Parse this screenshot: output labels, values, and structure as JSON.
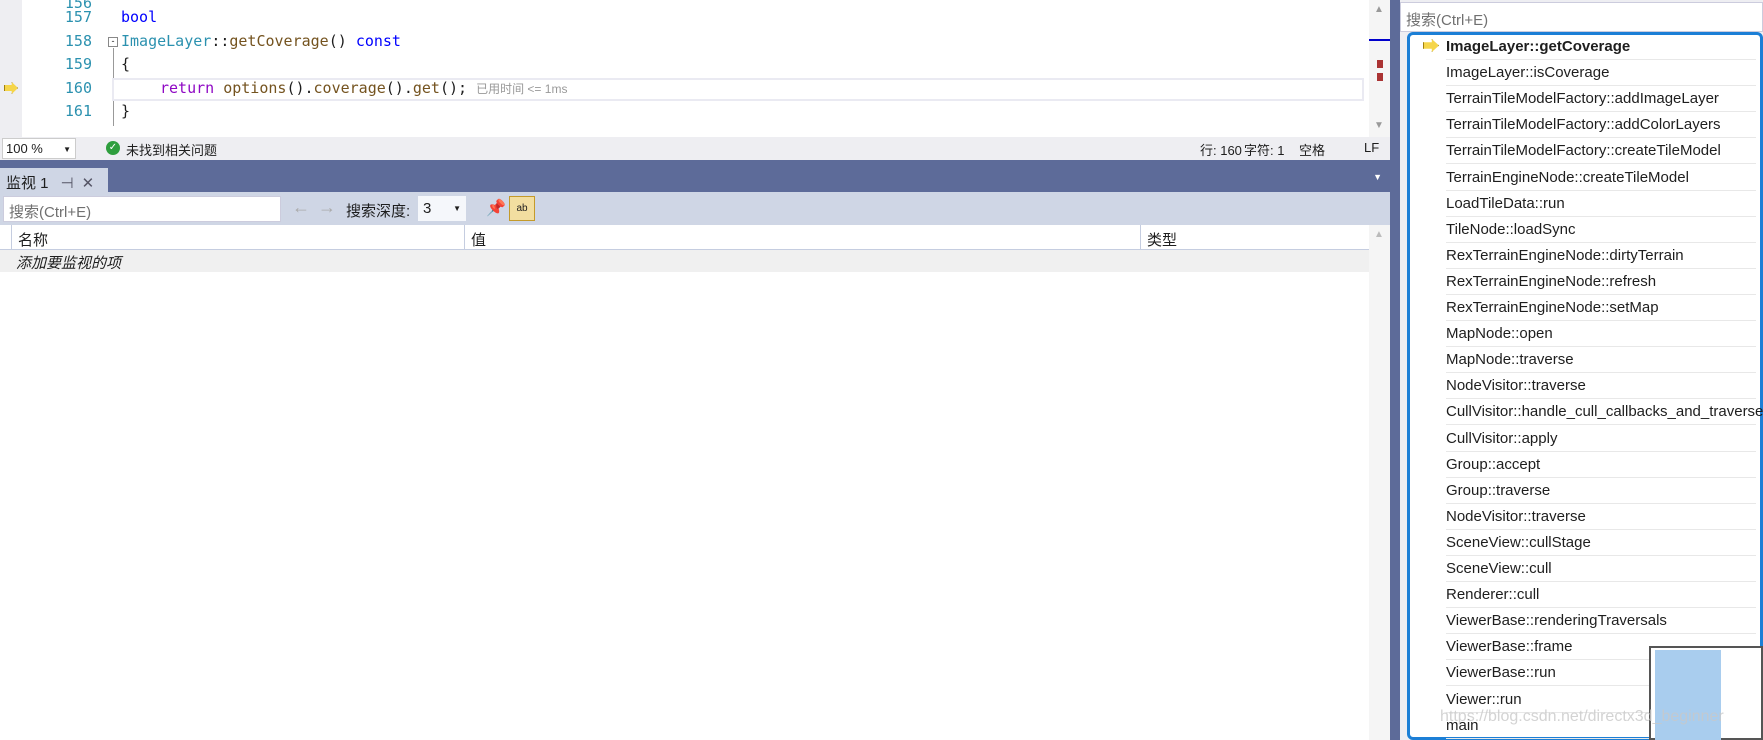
{
  "editor": {
    "lines": [
      {
        "n": "157"
      },
      {
        "n": "158"
      },
      {
        "n": "159"
      },
      {
        "n": "160"
      },
      {
        "n": "161"
      }
    ],
    "code": {
      "l157": "bool",
      "l158_class": "ImageLayer",
      "l158_sep": "::",
      "l158_fn": "getCoverage",
      "l158_rest": "() ",
      "l158_const": "const",
      "l159": "{",
      "l160_ret": "return ",
      "l160_a": "options",
      "l160_b": "().",
      "l160_c": "coverage",
      "l160_d": "().",
      "l160_e": "get",
      "l160_f": "();",
      "l160_hint": "已用时间 <= 1ms",
      "l161": "}"
    }
  },
  "status": {
    "zoom": "100 %",
    "issues": "未找到相关问题",
    "line": "行: 160",
    "char": "字符: 1",
    "indent": "空格",
    "eol": "LF"
  },
  "watch": {
    "tab": "监视 1",
    "search_placeholder": "搜索(Ctrl+E)",
    "depth_label": "搜索深度:",
    "depth": "3",
    "col_name": "名称",
    "col_value": "值",
    "col_type": "类型",
    "add_item": "添加要监视的项"
  },
  "callstack": {
    "search_placeholder": "搜索(Ctrl+E)",
    "frames": [
      "ImageLayer::getCoverage",
      "ImageLayer::isCoverage",
      "TerrainTileModelFactory::addImageLayer",
      "TerrainTileModelFactory::addColorLayers",
      "TerrainTileModelFactory::createTileModel",
      "TerrainEngineNode::createTileModel",
      "LoadTileData::run",
      "TileNode::loadSync",
      "RexTerrainEngineNode::dirtyTerrain",
      "RexTerrainEngineNode::refresh",
      "RexTerrainEngineNode::setMap",
      "MapNode::open",
      "MapNode::traverse",
      "NodeVisitor::traverse",
      "CullVisitor::handle_cull_callbacks_and_traverse",
      "CullVisitor::apply",
      "Group::accept",
      "Group::traverse",
      "NodeVisitor::traverse",
      "SceneView::cullStage",
      "SceneView::cull",
      "Renderer::cull",
      "ViewerBase::renderingTraversals",
      "ViewerBase::frame",
      "ViewerBase::run",
      "Viewer::run",
      "main"
    ]
  },
  "watermark": "https://blog.csdn.net/directx3d_beginner"
}
